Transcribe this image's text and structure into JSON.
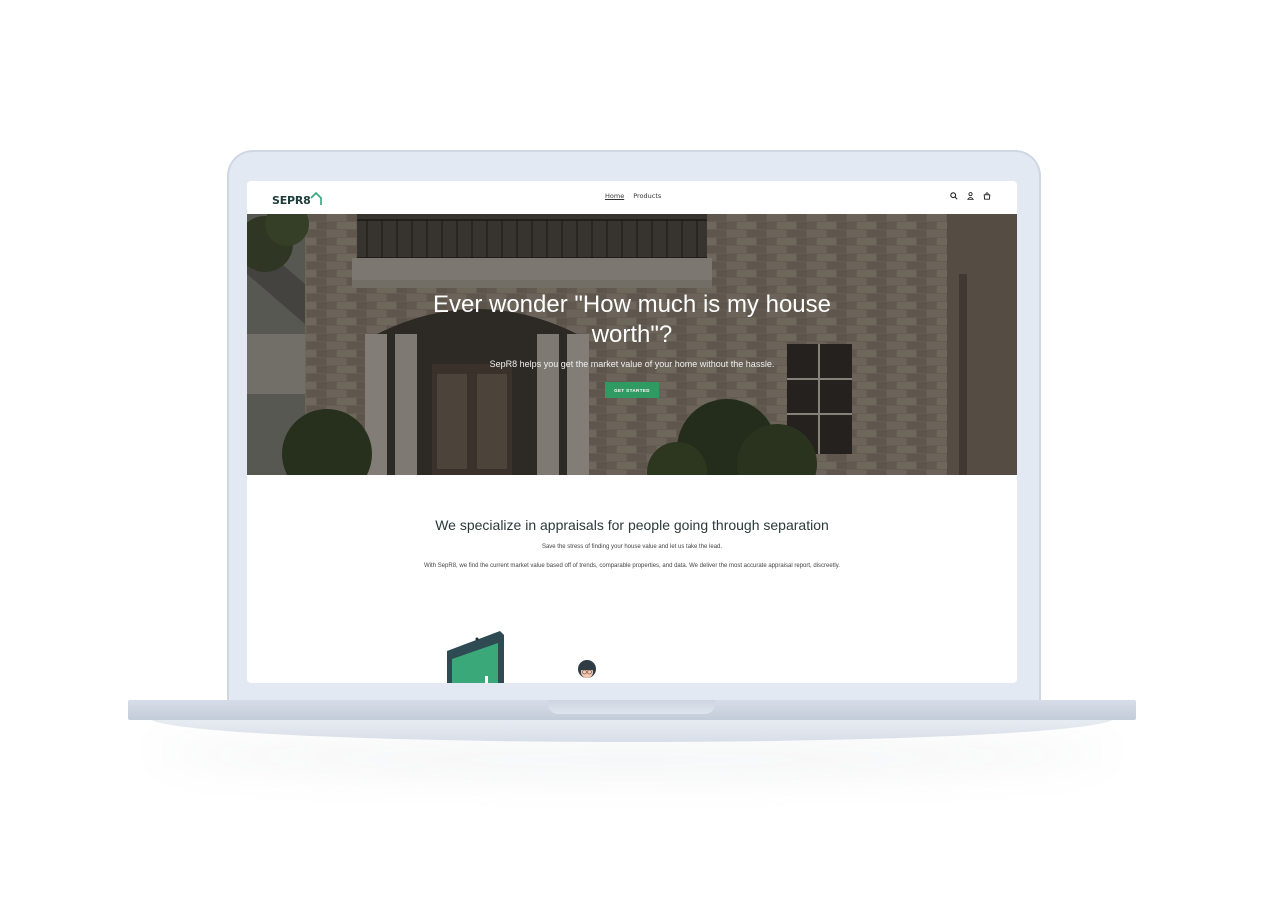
{
  "header": {
    "logo_text": "SEPR8",
    "nav": [
      {
        "label": "Home",
        "active": true
      },
      {
        "label": "Products",
        "active": false
      }
    ],
    "icons": [
      "search-icon",
      "account-icon",
      "cart-icon"
    ]
  },
  "hero": {
    "title": "Ever wonder \"How much is my house worth\"?",
    "subtitle": "SepR8 helps you get the market value of your home without the hassle.",
    "cta_label": "GET STARTED"
  },
  "intro": {
    "heading": "We specialize in appraisals for people going through separation",
    "line1": "Save the stress of finding your house value and let us take the lead.",
    "line2": "With SepR8, we find the current market value based off of trends, comparable properties, and data. We deliver the most accurate appraisal report, discreetly."
  },
  "colors": {
    "accent": "#2f9b63",
    "logo_accent": "#2fa77a",
    "heading": "#2b3a39"
  }
}
